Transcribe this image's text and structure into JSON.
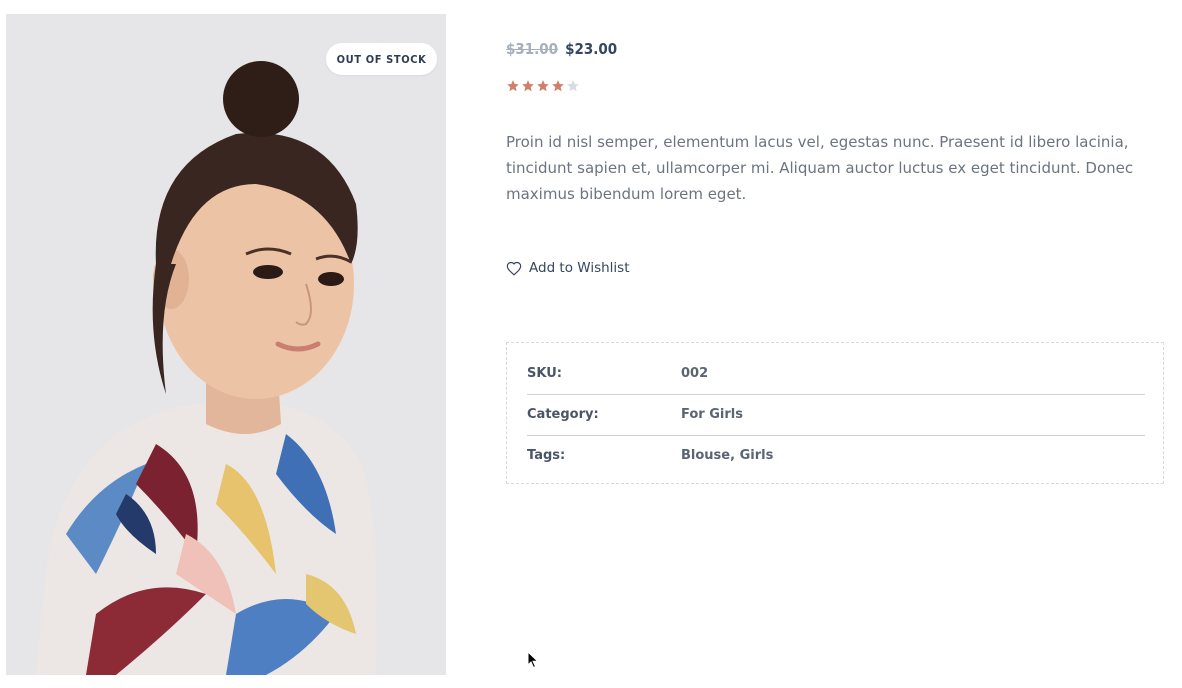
{
  "product": {
    "badge": "OUT OF STOCK",
    "price": {
      "old": "$31.00",
      "current": "$23.00"
    },
    "rating": 4,
    "rating_max": 5,
    "description": "Proin id nisl semper, elementum lacus vel, egestas nunc. Praesent id libero lacinia, tincidunt sapien et, ullamcorper mi. Aliquam auctor luctus ex eget tincidunt. Donec maximus bibendum lorem eget.",
    "wishlist_label": "Add to Wishlist",
    "wishlist_icon": "heart-icon"
  },
  "meta": {
    "sku_label": "SKU:",
    "sku_value": "002",
    "category_label": "Category:",
    "category_value": "For Girls",
    "tags_label": "Tags:",
    "tags_value": "Blouse, Girls"
  },
  "colors": {
    "star_filled": "#d0806a",
    "star_empty": "#d8dbe0",
    "heading": "#37465f",
    "muted": "#a6afbb"
  }
}
